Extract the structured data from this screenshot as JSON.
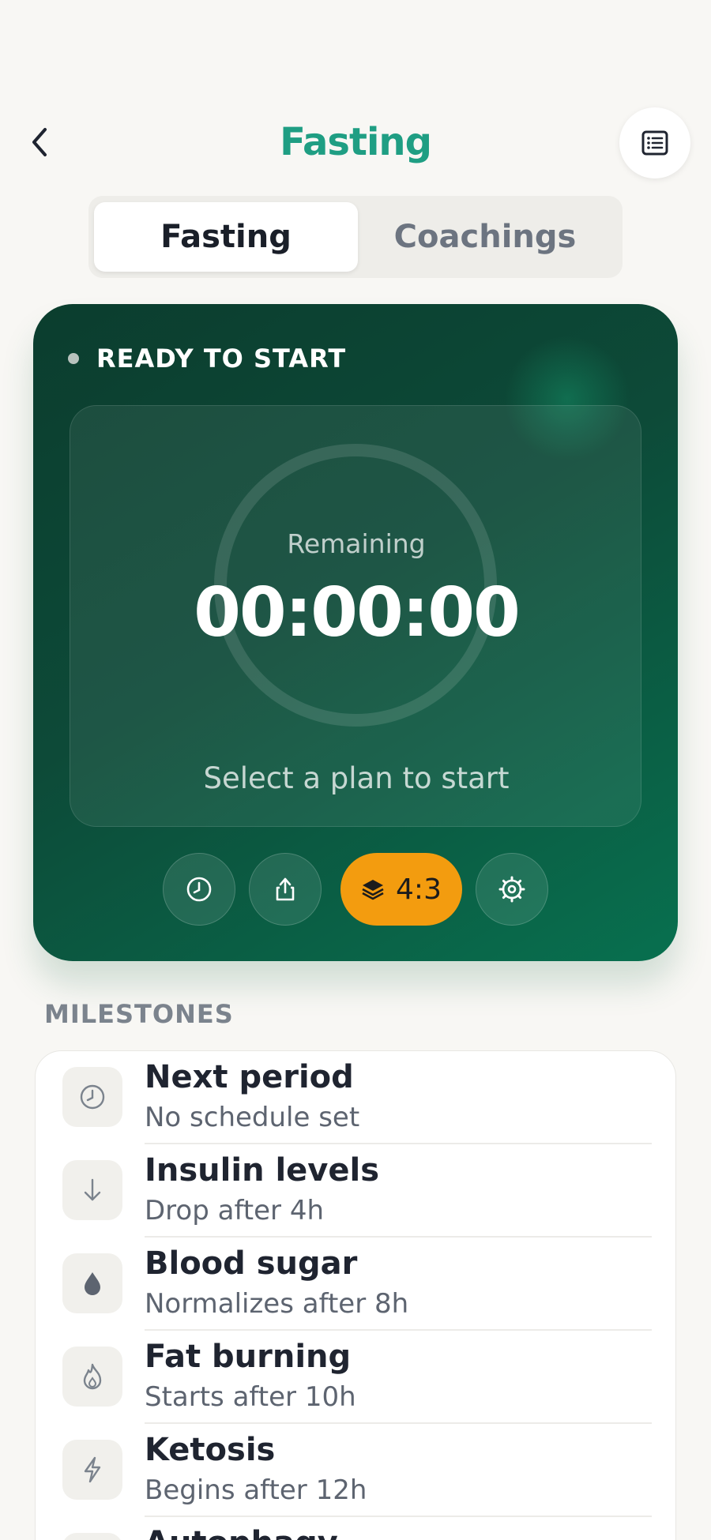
{
  "header": {
    "title": "Fasting",
    "back_icon": "chevron-left-icon",
    "list_icon": "list-icon"
  },
  "tabs": [
    {
      "label": "Fasting",
      "active": true
    },
    {
      "label": "Coachings",
      "active": false
    }
  ],
  "timer_card": {
    "status": "READY TO START",
    "remaining_label": "Remaining",
    "time": "00:00:00",
    "hint": "Select a plan to start",
    "controls": [
      {
        "icon": "clock-icon"
      },
      {
        "icon": "share-icon"
      },
      {
        "icon": "layers-icon",
        "label": "4:3"
      },
      {
        "icon": "settings-icon"
      }
    ]
  },
  "milestones": {
    "heading": "MILESTONES",
    "items": [
      {
        "title": "Next period",
        "subtitle": "No schedule set",
        "icon": "clock-icon"
      },
      {
        "title": "Insulin levels",
        "subtitle": "Drop after 4h",
        "icon": "arrow-down-icon"
      },
      {
        "title": "Blood sugar",
        "subtitle": "Normalizes after 8h",
        "icon": "drop-icon"
      },
      {
        "title": "Fat burning",
        "subtitle": "Starts after 10h",
        "icon": "flame-icon"
      },
      {
        "title": "Ketosis",
        "subtitle": "Begins after 12h",
        "icon": "bolt-icon"
      },
      {
        "title": "Autophagy",
        "subtitle": "",
        "icon": "recycle-icon"
      }
    ]
  },
  "colors": {
    "accent": "#1f9e83",
    "card_dark": "#0b3d2e",
    "plan_pill": "#f39c0f",
    "background": "#f8f7f4"
  }
}
